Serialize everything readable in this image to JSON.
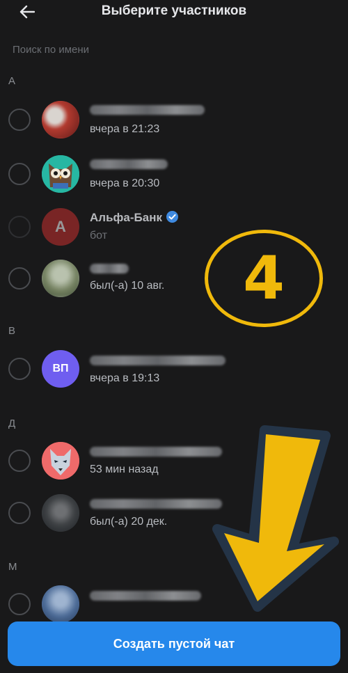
{
  "header": {
    "title": "Выберите участников",
    "back_icon": "arrow-left-icon"
  },
  "search": {
    "placeholder": "Поиск по имени"
  },
  "sections": {
    "a": "А",
    "v": "В",
    "d": "Д",
    "m": "М"
  },
  "contacts": [
    {
      "status": "вчера в 21:23"
    },
    {
      "status": "вчера в 20:30"
    },
    {
      "name": "Альфа-Банк",
      "status": "бот",
      "avatar_letter": "А",
      "verified": true,
      "disabled": true
    },
    {
      "status": "был(-а) 10 авг."
    },
    {
      "status": "вчера в 19:13",
      "avatar_initials": "ВП"
    },
    {
      "status": "53 мин назад"
    },
    {
      "status": "был(-а) 20 дек."
    },
    {
      "status": ""
    }
  ],
  "overlay": {
    "step_number": "4",
    "accent_color": "#f0b90b"
  },
  "footer": {
    "create_button_label": "Создать пустой чат"
  },
  "colors": {
    "background": "#19191a",
    "primary": "#2688eb"
  }
}
